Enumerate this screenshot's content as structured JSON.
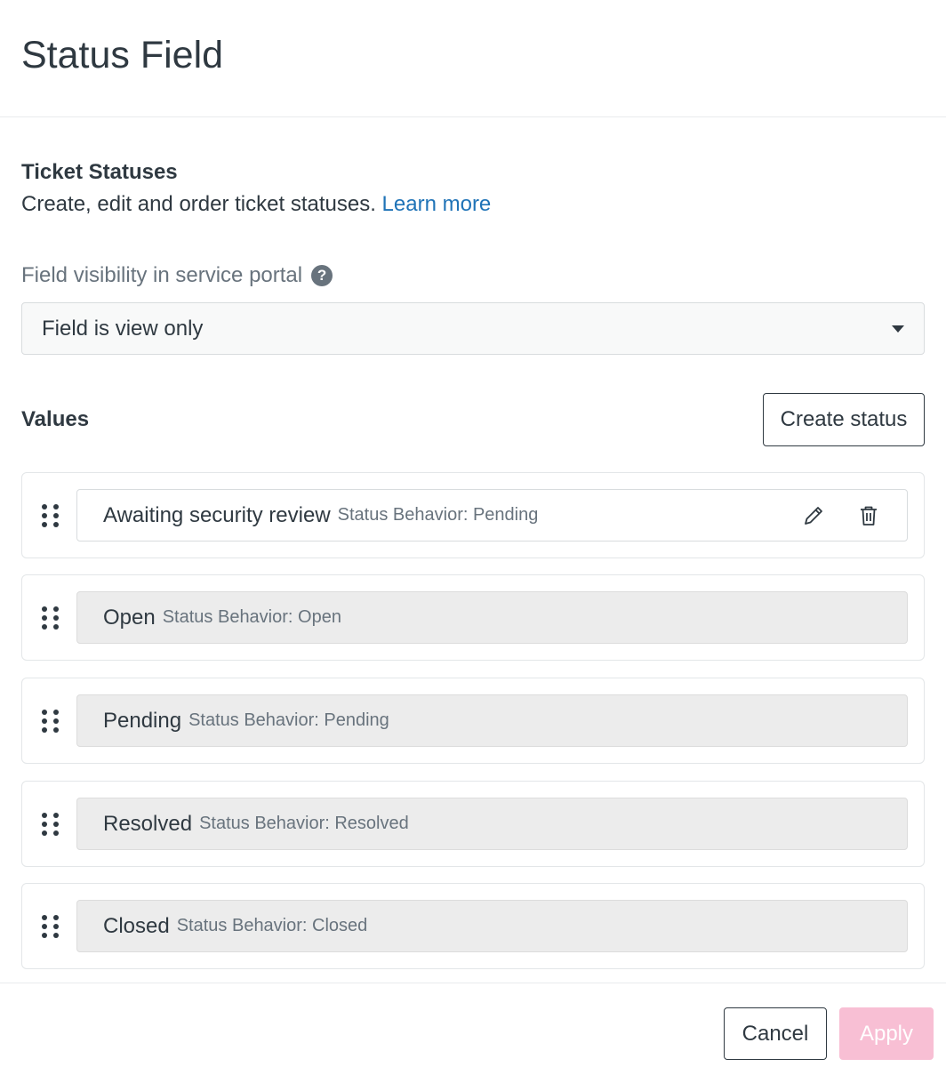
{
  "header": {
    "title": "Status Field"
  },
  "ticket_statuses": {
    "heading": "Ticket Statuses",
    "description": "Create, edit and order ticket statuses.",
    "learn_more": "Learn more"
  },
  "visibility": {
    "label": "Field visibility in service portal",
    "help_icon": "?",
    "selected": "Field is view only"
  },
  "values": {
    "heading": "Values",
    "create_button": "Create status",
    "items": [
      {
        "name": "Awaiting security review",
        "behavior": "Status Behavior: Pending"
      },
      {
        "name": "Open",
        "behavior": "Status Behavior: Open"
      },
      {
        "name": "Pending",
        "behavior": "Status Behavior: Pending"
      },
      {
        "name": "Resolved",
        "behavior": "Status Behavior: Resolved"
      },
      {
        "name": "Closed",
        "behavior": "Status Behavior: Closed"
      }
    ]
  },
  "footer": {
    "cancel": "Cancel",
    "apply": "Apply"
  },
  "colors": {
    "link": "#1f73b7",
    "apply_disabled": "#f8bfd4",
    "row_bg": "#ececec"
  }
}
